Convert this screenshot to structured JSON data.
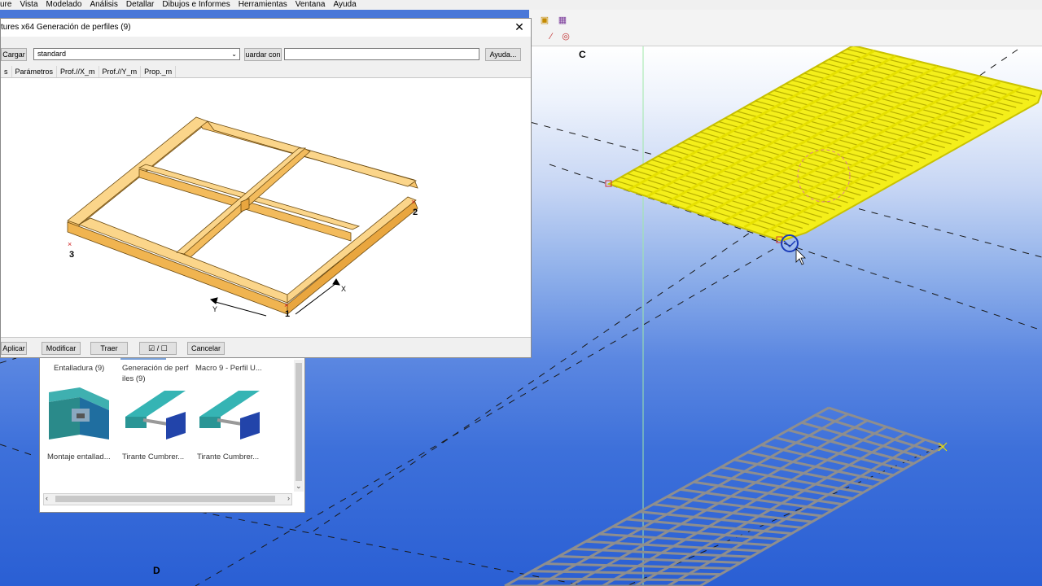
{
  "menu": [
    "ure",
    "Vista",
    "Modelado",
    "Análisis",
    "Detallar",
    "Dibujos e Informes",
    "Herramientas",
    "Ventana",
    "Ayuda"
  ],
  "dialog": {
    "title": "tures x64  Generación de perfiles (9)",
    "load_button": "Cargar",
    "preset_value": "standard",
    "save_as_button": "uardar con",
    "save_as_value": "",
    "help_button": "Ayuda...",
    "tabs": [
      "s",
      "Parámetros",
      "Prof.//X_m",
      "Prof.//Y_m",
      "Prop._m"
    ],
    "preview_labels": {
      "p1": "1",
      "p2": "2",
      "p3": "3",
      "axis_x": "X",
      "axis_y": "Y"
    },
    "buttons": {
      "apply": "Aplicar",
      "modify": "Modificar",
      "get": "Traer",
      "cancel": "Cancelar"
    },
    "checkbox_toggle": "/"
  },
  "catalog": {
    "items": [
      {
        "label": "Entalladura (9)",
        "icon": "notch-icon"
      },
      {
        "label": "Generación de perf iles (9)",
        "icon": "profile-generation-icon"
      },
      {
        "label": "Macro 9 - Perfil U...",
        "icon": "macro-icon"
      },
      {
        "label": "Montaje entallad...",
        "icon": "notch-assembly-icon"
      },
      {
        "label": "Tirante Cumbrer...",
        "icon": "ridge-tie-icon"
      },
      {
        "label": "Tirante Cumbrer...",
        "icon": "ridge-tie-icon"
      }
    ]
  },
  "viewport": {
    "grid_labels": {
      "c": "C",
      "d": "D"
    }
  },
  "colors": {
    "selected": "#ffff00",
    "beam": "#f7c46c",
    "grating": "#8e8e8e",
    "background_bottom": "#2a5fd4"
  }
}
